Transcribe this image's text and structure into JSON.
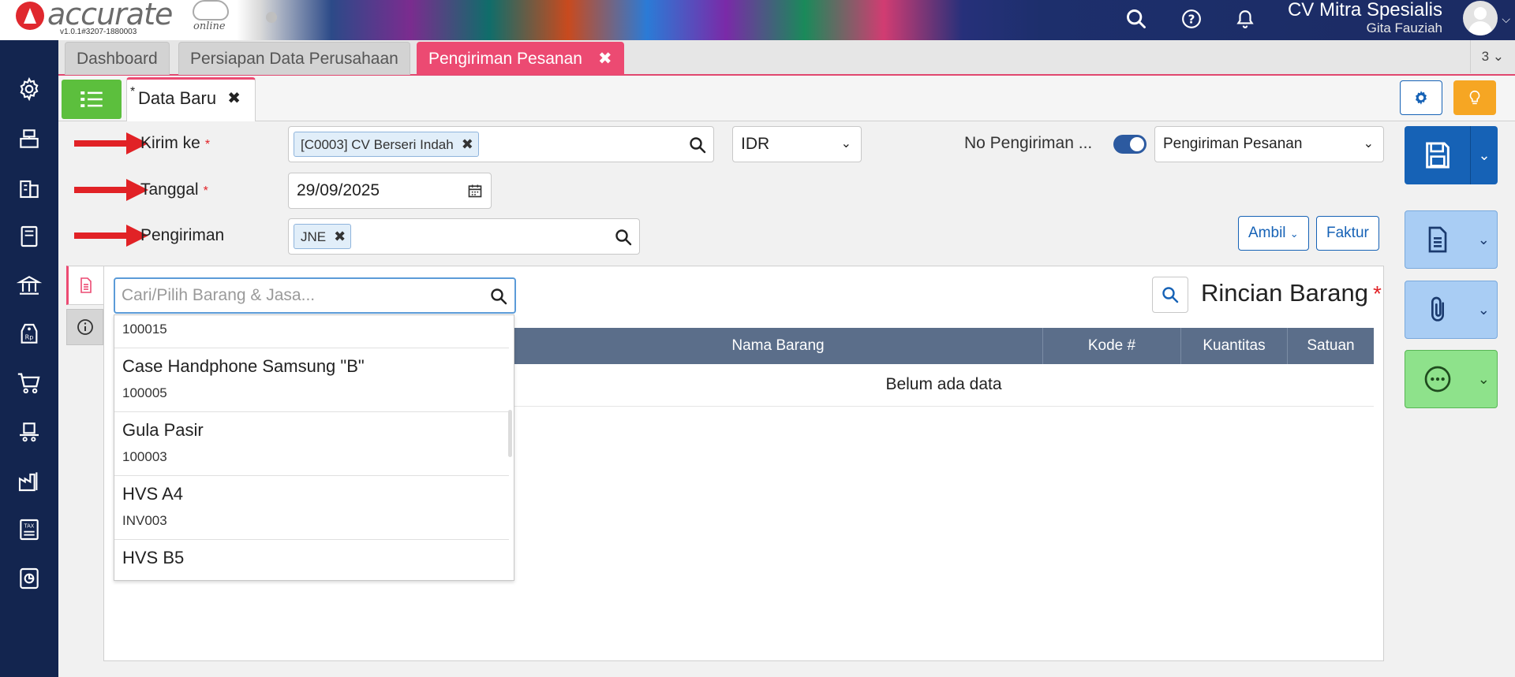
{
  "header": {
    "logo_text": "accurate",
    "logo_sub": "online",
    "version": "v1.0.1#3207-1880003",
    "company": "CV Mitra Spesialis",
    "user": "Gita Fauziah"
  },
  "tabs": [
    {
      "label": "Dashboard"
    },
    {
      "label": "Persiapan Data Perusahaan"
    },
    {
      "label": "Pengiriman Pesanan",
      "active": true
    }
  ],
  "tab_count": "3",
  "subtab": {
    "label": "Data Baru",
    "star": "*"
  },
  "form": {
    "kirim_ke_label": "Kirim ke",
    "kirim_ke_value": "[C0003] CV Berseri Indah",
    "currency": "IDR",
    "no_pengiriman_label": "No Pengiriman ...",
    "type_select": "Pengiriman Pesanan",
    "tanggal_label": "Tanggal",
    "tanggal_value": "29/09/2025",
    "pengiriman_label": "Pengiriman",
    "pengiriman_value": "JNE",
    "required_mark": "*"
  },
  "actions": {
    "ambil": "Ambil",
    "faktur": "Faktur"
  },
  "item_search": {
    "placeholder": "Cari/Pilih Barang & Jasa..."
  },
  "dropdown_items": [
    {
      "name": "",
      "code": "100015"
    },
    {
      "name": "Case Handphone Samsung \"B\"",
      "code": "100005"
    },
    {
      "name": "Gula Pasir",
      "code": "100003"
    },
    {
      "name": "HVS A4",
      "code": "INV003"
    },
    {
      "name": "HVS B5",
      "code": ""
    }
  ],
  "rincian": {
    "title": "Rincian Barang",
    "req": "*"
  },
  "table": {
    "columns": [
      "Nama Barang",
      "Kode #",
      "Kuantitas",
      "Satuan"
    ],
    "empty": "Belum ada data"
  },
  "colors": {
    "accent": "#ec4a72",
    "primary": "#1662b6",
    "sidebar": "#13254f",
    "green": "#5cbf3d"
  }
}
